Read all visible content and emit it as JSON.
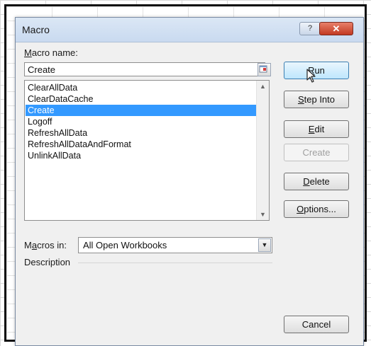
{
  "dialog": {
    "title": "Macro",
    "help_label": "?",
    "close_label": "✕"
  },
  "macro_name": {
    "label_prefix": "",
    "label_mnemonic": "M",
    "label_rest": "acro name:",
    "value": "Create"
  },
  "macro_list": {
    "items": [
      "ClearAllData",
      "ClearDataCache",
      "Create",
      "Logoff",
      "RefreshAllData",
      "RefreshAllDataAndFormat",
      "UnlinkAllData"
    ],
    "selected": "Create"
  },
  "buttons": {
    "run": {
      "pre": "",
      "mn": "R",
      "post": "un"
    },
    "step_into": {
      "pre": "",
      "mn": "S",
      "post": "tep Into"
    },
    "edit": {
      "pre": "",
      "mn": "E",
      "post": "dit"
    },
    "create": "Create",
    "delete": {
      "pre": "",
      "mn": "D",
      "post": "elete"
    },
    "options": {
      "pre": "",
      "mn": "O",
      "post": "ptions..."
    },
    "cancel": "Cancel"
  },
  "macros_in": {
    "label_pre": "M",
    "label_mn": "a",
    "label_post": "cros in:",
    "value": "All Open Workbooks"
  },
  "description": {
    "label": "Description"
  },
  "colors": {
    "selection": "#3399ff",
    "close_button": "#c23a22",
    "titlebar": "#c9daf0"
  }
}
